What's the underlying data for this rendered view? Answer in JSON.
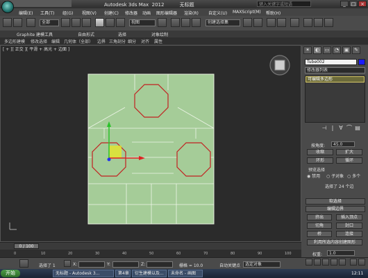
{
  "window": {
    "title": "Autodesk 3ds Max  2012          无标题",
    "search_placeholder": "键入关键字或短语",
    "min": "_",
    "max": "□",
    "close": "×"
  },
  "menu": [
    "编辑(E)",
    "工具(T)",
    "组(G)",
    "视图(V)",
    "创建(C)",
    "修改器",
    "动画",
    "图形编辑器",
    "渲染(R)",
    "自定义(U)",
    "MAXScript(M)",
    "帮助(H)"
  ],
  "toolbar": {
    "selection_filter": "全部",
    "coord_system": "视图",
    "named_selection": "创建选择集"
  },
  "ribbon": {
    "tabs": [
      "Graphite 建模工具",
      "自由形式",
      "选择",
      "对象绘制"
    ],
    "subtabs": [
      "多边形建模",
      "修改选择",
      "编辑",
      "几何体（全部）",
      "边界",
      "三角剖分",
      "细分",
      "对齐",
      "属性"
    ]
  },
  "viewport": {
    "label": "[ + ][ 正交 ][ 平滑 + 高光 + 边面 ]"
  },
  "panel": {
    "tabs": [
      "✶",
      "◐",
      "▭",
      "◔",
      "▣",
      "✎"
    ],
    "object_name": "Tube002",
    "object_color": "#1c1cff",
    "modifier_list": "修改器列表",
    "stack_item": "可编辑多边形",
    "stack_buttons": [
      "⊣",
      "|",
      "∀",
      "⌒",
      "▤"
    ],
    "soft_selection": {
      "use_label": "按角度:",
      "angle": "45.0",
      "shrink": "收缩",
      "grow": "扩大",
      "ring": "环形",
      "loop": "循环"
    },
    "preview": {
      "title": "预览选择",
      "option_off": "禁用",
      "option_sub": "子对象",
      "option_multi": "多个"
    },
    "status": "选择了 24 个边",
    "rollout_soft": "软选择",
    "rollout_edit": "编辑边界",
    "edit_buttons": [
      "挤出",
      "插入顶点",
      "切角",
      "封口",
      "桥",
      "连接"
    ],
    "create_shape": "利用所选内容创建图形",
    "weight_label": "权重:",
    "weight_value": "1.0"
  },
  "timeline": {
    "frame": "0 / 100",
    "ticks": [
      "0",
      "10",
      "20",
      "30",
      "40",
      "50",
      "60",
      "70",
      "80",
      "90",
      "100"
    ]
  },
  "status": {
    "selected": "选择了 1",
    "x_label": "X:",
    "y_label": "Y:",
    "z_label": "Z:",
    "grid": "栅格 = 10.0",
    "autokey": "自动关键点",
    "set_key_dropdown": "选定对象"
  },
  "taskbar": {
    "start": "开始",
    "tasks": [
      "无标题 - Autodesk 3...",
      "第4章",
      "衍生建模以及...",
      "未命名 - 画图"
    ],
    "clock": "12:11"
  }
}
